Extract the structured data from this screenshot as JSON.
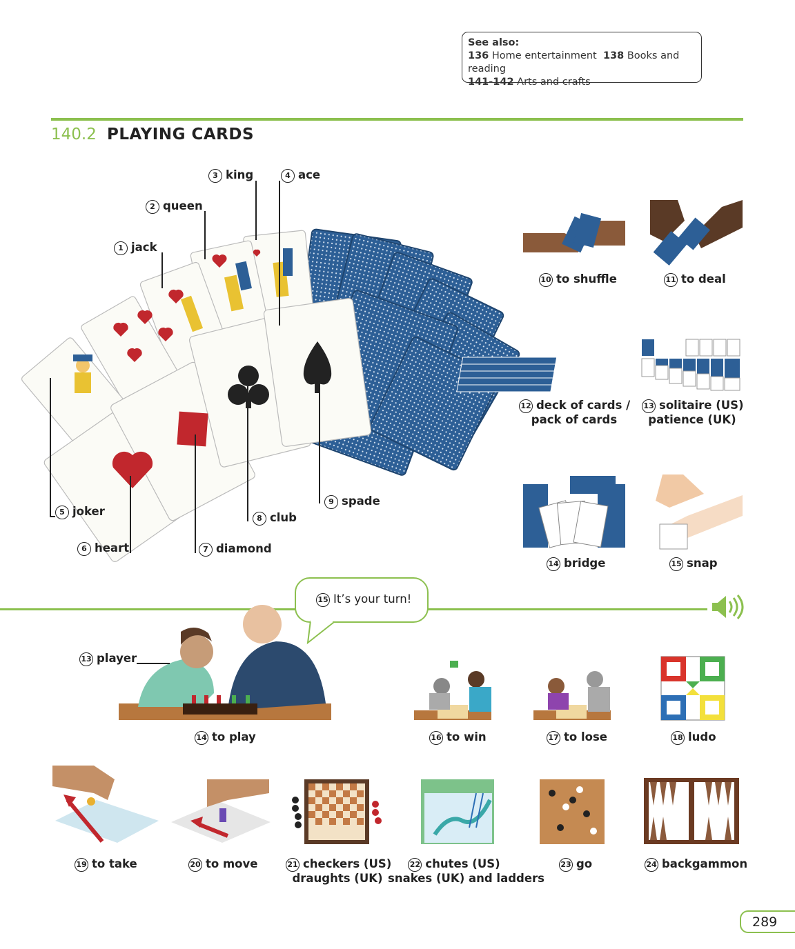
{
  "see_also": {
    "heading": "See also:",
    "row1_num1": "136",
    "row1_text1": "Home entertainment",
    "row1_num2": "138",
    "row1_text2": "Books and reading",
    "row2_num": "141-142",
    "row2_text": "Arts and crafts"
  },
  "section": {
    "number": "140.2",
    "title": "PLAYING CARDS"
  },
  "card_labels": [
    {
      "n": "1",
      "text": "jack"
    },
    {
      "n": "2",
      "text": "queen"
    },
    {
      "n": "3",
      "text": "king"
    },
    {
      "n": "4",
      "text": "ace"
    },
    {
      "n": "5",
      "text": "joker"
    },
    {
      "n": "6",
      "text": "heart"
    },
    {
      "n": "7",
      "text": "diamond"
    },
    {
      "n": "8",
      "text": "club"
    },
    {
      "n": "9",
      "text": "spade"
    }
  ],
  "right_items": [
    {
      "n": "10",
      "line1": "to shuffle",
      "line2": ""
    },
    {
      "n": "11",
      "line1": "to deal",
      "line2": ""
    },
    {
      "n": "12",
      "line1": "deck of cards /",
      "line2": "pack of cards"
    },
    {
      "n": "13",
      "line1": "solitaire (US)",
      "line2": "patience (UK)"
    },
    {
      "n": "14",
      "line1": "bridge",
      "line2": ""
    },
    {
      "n": "15",
      "line1": "snap",
      "line2": ""
    }
  ],
  "speech": {
    "n": "15",
    "text": "It’s your turn!"
  },
  "player_label": {
    "n": "13",
    "text": "player"
  },
  "row_a": [
    {
      "n": "14",
      "text": "to play"
    },
    {
      "n": "16",
      "text": "to win"
    },
    {
      "n": "17",
      "text": "to lose"
    },
    {
      "n": "18",
      "text": "ludo"
    }
  ],
  "row_b": [
    {
      "n": "19",
      "line1": "to take",
      "line2": ""
    },
    {
      "n": "20",
      "line1": "to move",
      "line2": ""
    },
    {
      "n": "21",
      "line1": "checkers (US)",
      "line2": "draughts (UK)"
    },
    {
      "n": "22",
      "line1": "chutes (US)",
      "line2": "snakes (UK) and ladders"
    },
    {
      "n": "23",
      "line1": "go",
      "line2": ""
    },
    {
      "n": "24",
      "line1": "backgammon",
      "line2": ""
    }
  ],
  "page_number": "289",
  "icons": {
    "audio": "speaker-icon"
  },
  "colors": {
    "accent": "#8cc04f",
    "card_back": "#2d5f96",
    "card_red": "#c1272d"
  }
}
